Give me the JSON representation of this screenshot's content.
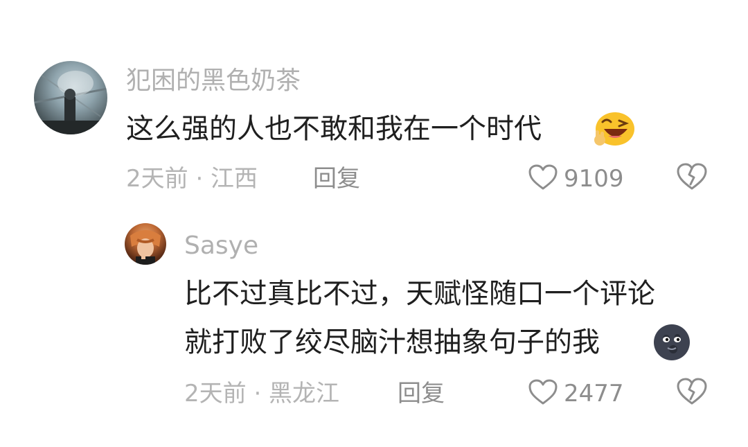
{
  "comments": [
    {
      "username": "犯困的黑色奶茶",
      "text": "这么强的人也不敢和我在一个时代",
      "emoji": "laughing-winking-peace-emoji",
      "meta": "2天前 · 江西",
      "reply_label": "回复",
      "like_count": "9109"
    }
  ],
  "reply": {
    "username": "Sasye",
    "text_line1": "比不过真比不过，天赋怪随口一个评论",
    "text_line2": "就打败了绞尽脑汁想抽象句子的我",
    "emoji": "black-moon-face-emoji",
    "meta": "2天前 · 黑龙江",
    "reply_label": "回复",
    "like_count": "2477"
  },
  "icons": {
    "like": "heart-outline-icon",
    "dislike": "broken-heart-icon"
  },
  "colors": {
    "username": "#b0b0b0",
    "body_text": "#1f1f1f",
    "meta": "#b4b4b4",
    "action": "#8d8d8d"
  }
}
